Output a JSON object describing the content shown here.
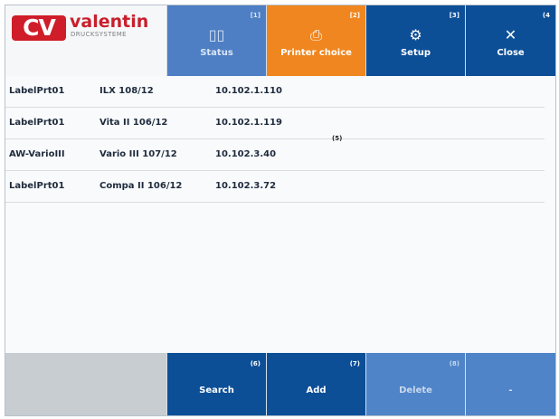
{
  "brand": {
    "mark": "CV",
    "name": "valentin",
    "subtitle": "DRUCKSYSTEME"
  },
  "tabs": [
    {
      "num": "[1]",
      "icon": "▯▯",
      "label": "Status"
    },
    {
      "num": "[2]",
      "icon": "⎙",
      "label": "Printer choice"
    },
    {
      "num": "[3]",
      "icon": "⚙",
      "label": "Setup"
    },
    {
      "num": "(4",
      "icon": "✕",
      "label": "Close"
    }
  ],
  "printers": [
    {
      "name": "LabelPrt01",
      "model": "ILX 108/12",
      "ip": "10.102.1.110"
    },
    {
      "name": "LabelPrt01",
      "model": "Vita II 106/12",
      "ip": "10.102.1.119"
    },
    {
      "name": "AW-VarioIII",
      "model": "Vario III 107/12",
      "ip": "10.102.3.40"
    },
    {
      "name": "LabelPrt01",
      "model": "Compa II 106/12",
      "ip": "10.102.3.72"
    }
  ],
  "marker": "(5)",
  "buttons": [
    {
      "num": "(6)",
      "label": "Search"
    },
    {
      "num": "(7)",
      "label": "Add"
    },
    {
      "num": "(8)",
      "label": "Delete"
    },
    {
      "num": "",
      "label": "-"
    }
  ],
  "colors": {
    "active_tab": "#f0861f",
    "primary": "#0d4f97",
    "inactive": "#4f84c8",
    "brand_red": "#cf1d2a"
  }
}
